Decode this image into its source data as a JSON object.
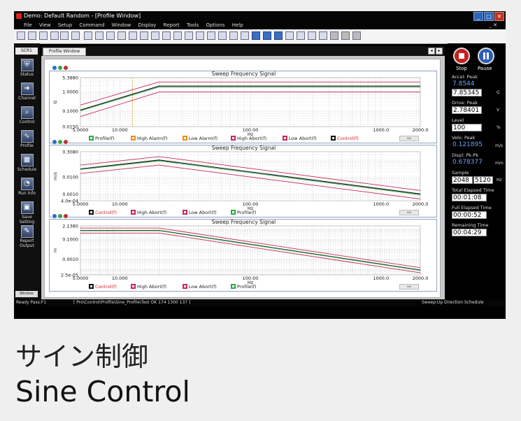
{
  "window": {
    "title": "Demo: Default Random - [Profile Window]"
  },
  "menu": [
    "File",
    "View",
    "Setup",
    "Command",
    "Window",
    "Display",
    "Report",
    "Tools",
    "Options",
    "Help"
  ],
  "menu_right": "_ ✕",
  "sidebar": {
    "header": "SCR1",
    "items": [
      {
        "label": "Status",
        "icon": "shield-icon"
      },
      {
        "label": "Channel",
        "icon": "arrow-right-icon"
      },
      {
        "label": "Control",
        "icon": "magnifier-icon"
      },
      {
        "label": "Profile",
        "icon": "waveform-icon"
      },
      {
        "label": "Schedule",
        "icon": "grid-icon"
      },
      {
        "label": "Run Info",
        "icon": "gauge-icon"
      },
      {
        "label": "Save Setting",
        "icon": "disk-icon"
      },
      {
        "label": "Report Output",
        "icon": "report-icon"
      }
    ],
    "footer": "Window"
  },
  "main": {
    "tab": "Profile Window",
    "nav_prev": "◂",
    "nav_next": "▸"
  },
  "right_panel": {
    "stop_label": "Stop",
    "pause_label": "Pause",
    "fields": [
      {
        "label": "Accel: Peak",
        "value": "7.8544",
        "box": "7.85345",
        "unit": "G"
      },
      {
        "label": "Drive: Peak",
        "value": "",
        "box": "2.78401",
        "unit": "V"
      },
      {
        "label": "Level",
        "value": "",
        "box": "100",
        "unit": "%"
      },
      {
        "label": "Velo: Peak",
        "value": "0.121895",
        "box": "",
        "unit": "m/s"
      },
      {
        "label": "Displ: Pk-Pk",
        "value": "0.678377",
        "box": "",
        "unit": "mm"
      },
      {
        "label": "Sample",
        "value": "",
        "box": "2048",
        "box2": "5120",
        "unit": "Hz"
      },
      {
        "label": "Total Elapsed Time",
        "value": "",
        "box": "00:01:08",
        "unit": ""
      },
      {
        "label": "Full Elapsed Time",
        "value": "",
        "box": "00:00:52",
        "unit": ""
      },
      {
        "label": "Remaining Time",
        "value": "",
        "box": "00:04:29",
        "unit": ""
      }
    ]
  },
  "statusbar": {
    "left": "Ready  Pass:F1",
    "middle": "[ Pro\\Control\\Profile\\Sine_Profile\\Test  OK  174  1300  137 ]",
    "right": "Sweep:Up   Direction   Schedule"
  },
  "charts_meta": [
    {
      "legend": [
        {
          "label": "Profile(f)",
          "color": "#2fa84a",
          "text": "#222"
        },
        {
          "label": "High Alarm(f)",
          "color": "#f08c1e",
          "text": "#222"
        },
        {
          "label": "Low Alarm(f)",
          "color": "#f08c1e",
          "text": "#222"
        },
        {
          "label": "High Abort(f)",
          "color": "#c8285a",
          "text": "#222"
        },
        {
          "label": "Low Abort(f)",
          "color": "#c8285a",
          "text": "#222"
        },
        {
          "label": "Control(f)",
          "color": "#111111",
          "text": "#d02020"
        }
      ]
    },
    {
      "legend": [
        {
          "label": "Control(f)",
          "color": "#111111",
          "text": "#d02020"
        },
        {
          "label": "High Abort(f)",
          "color": "#c8285a",
          "text": "#222"
        },
        {
          "label": "Low Abort(f)",
          "color": "#c8285a",
          "text": "#222"
        },
        {
          "label": "Profile(f)",
          "color": "#2fa84a",
          "text": "#222"
        }
      ]
    },
    {
      "legend": [
        {
          "label": "Control(f)",
          "color": "#111111",
          "text": "#d02020"
        },
        {
          "label": "High Abort(f)",
          "color": "#c8285a",
          "text": "#222"
        },
        {
          "label": "Low Abort(f)",
          "color": "#c8285a",
          "text": "#222"
        },
        {
          "label": "Profile(f)",
          "color": "#2fa84a",
          "text": "#222"
        }
      ]
    }
  ],
  "chart_data": [
    {
      "type": "line",
      "title": "Sweep Frequency Signal",
      "xlabel": "Hz",
      "ylabel": "G",
      "xscale": "log",
      "yscale": "log",
      "xlim": [
        5,
        2000
      ],
      "ylim": [
        0.015,
        5.388
      ],
      "xticks": [
        "5.0000",
        "10.000",
        "100.00",
        "1000.0",
        "2000.0"
      ],
      "yticks": [
        "5.3880",
        "1.0000",
        "0.1000",
        "0.0150"
      ],
      "series": [
        {
          "name": "High Abort(f)",
          "color": "#c8285a",
          "x": [
            5,
            20,
            2000
          ],
          "y": [
            0.2,
            3.2,
            3.2
          ]
        },
        {
          "name": "Control(f)",
          "color": "#111111",
          "x": [
            5,
            20,
            2000
          ],
          "y": [
            0.11,
            1.95,
            1.95
          ]
        },
        {
          "name": "Profile(f)",
          "color": "#2fa84a",
          "x": [
            5,
            20,
            2000
          ],
          "y": [
            0.1,
            1.75,
            1.75
          ]
        },
        {
          "name": "Low Abort(f)",
          "color": "#c8285a",
          "x": [
            5,
            20,
            2000
          ],
          "y": [
            0.05,
            0.95,
            0.95
          ]
        }
      ]
    },
    {
      "type": "line",
      "title": "Sweep Frequency Signal",
      "xlabel": "Hz",
      "ylabel": "m/s",
      "xscale": "log",
      "yscale": "log",
      "xlim": [
        5,
        2000
      ],
      "ylim": [
        0.0004,
        0.308
      ],
      "xticks": [
        "5.0000",
        "10.000",
        "100.00",
        "1000.0",
        "2000.0"
      ],
      "yticks": [
        "0.3080",
        "0.0100",
        "0.0010",
        "4.0e-04"
      ],
      "series": [
        {
          "name": "High Abort(f)",
          "color": "#c8285a",
          "x": [
            5,
            20,
            2000
          ],
          "y": [
            0.05,
            0.16,
            0.0016
          ]
        },
        {
          "name": "Control(f)",
          "color": "#111111",
          "x": [
            5,
            20,
            2000
          ],
          "y": [
            0.03,
            0.1,
            0.001
          ]
        },
        {
          "name": "Profile(f)",
          "color": "#2fa84a",
          "x": [
            5,
            20,
            2000
          ],
          "y": [
            0.028,
            0.09,
            0.0009
          ]
        },
        {
          "name": "Low Abort(f)",
          "color": "#c8285a",
          "x": [
            5,
            20,
            2000
          ],
          "y": [
            0.016,
            0.05,
            0.0005
          ]
        }
      ]
    },
    {
      "type": "line",
      "title": "Sweep Frequency Signal",
      "xlabel": "Hz",
      "ylabel": "m",
      "xscale": "log",
      "yscale": "log",
      "xlim": [
        5,
        2000
      ],
      "ylim": [
        2.5e-05,
        2.138
      ],
      "xticks": [
        "5.0000",
        "10.000",
        "100.00",
        "1000.0",
        "2000.0"
      ],
      "yticks": [
        "2.1380",
        "0.1000",
        "0.0010",
        "2.5e-05"
      ],
      "series": [
        {
          "name": "High Abort(f)",
          "color": "#c8285a",
          "x": [
            5,
            20,
            2000
          ],
          "y": [
            1.3,
            1.3,
            0.00013
          ]
        },
        {
          "name": "Control(f)",
          "color": "#111111",
          "x": [
            5,
            20,
            2000
          ],
          "y": [
            0.75,
            0.75,
            7.5e-05
          ]
        },
        {
          "name": "Profile(f)",
          "color": "#2fa84a",
          "x": [
            5,
            20,
            2000
          ],
          "y": [
            0.7,
            0.7,
            7e-05
          ]
        },
        {
          "name": "Low Abort(f)",
          "color": "#c8285a",
          "x": [
            5,
            20,
            2000
          ],
          "y": [
            0.4,
            0.4,
            4e-05
          ]
        }
      ]
    }
  ],
  "caption": {
    "jp": "サイン制御",
    "en": "Sine Control"
  }
}
